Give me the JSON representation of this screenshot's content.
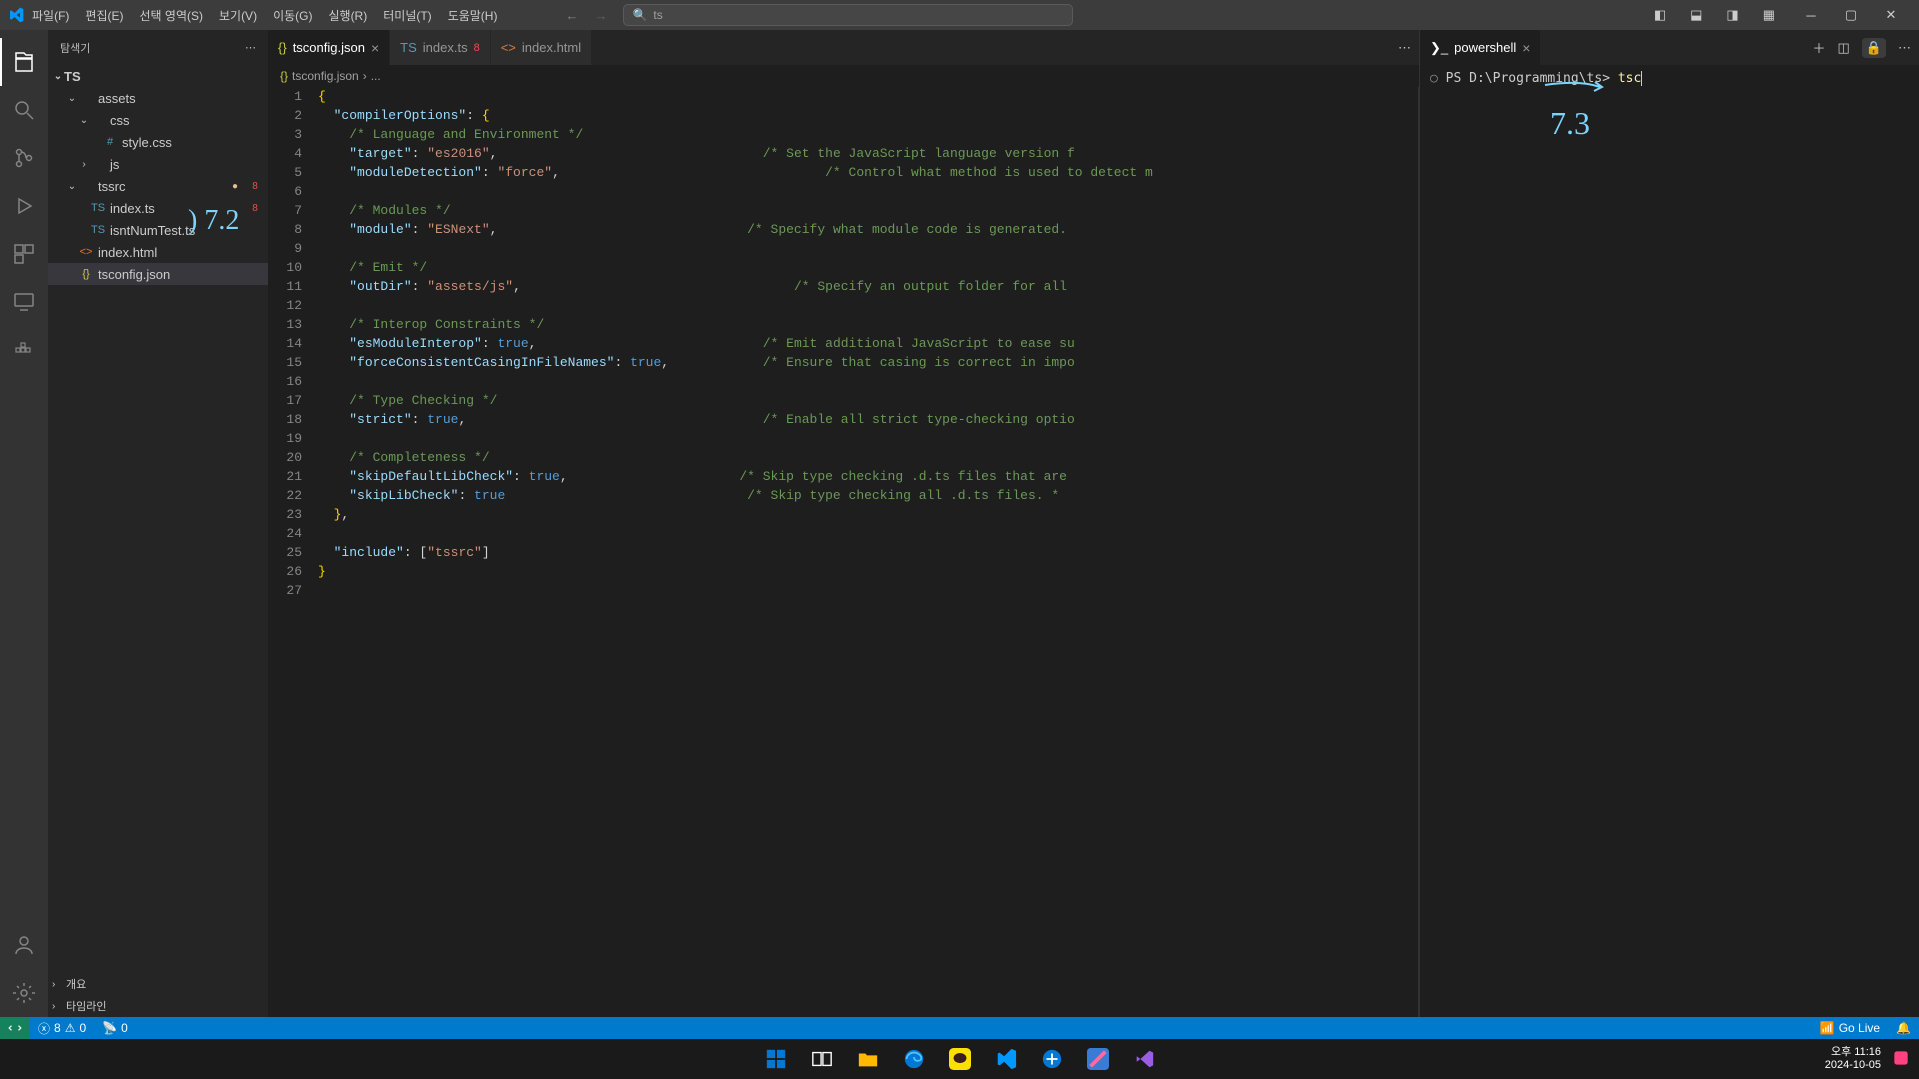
{
  "menu": [
    "파일(F)",
    "편집(E)",
    "선택 영역(S)",
    "보기(V)",
    "이동(G)",
    "실행(R)",
    "터미널(T)",
    "도움말(H)"
  ],
  "search_text": "ts",
  "sidebar": {
    "title": "탐색기",
    "root": "TS",
    "tree": [
      {
        "type": "folder",
        "depth": 1,
        "open": true,
        "label": "assets",
        "icon": ""
      },
      {
        "type": "folder",
        "depth": 2,
        "open": true,
        "label": "css",
        "icon": ""
      },
      {
        "type": "file",
        "depth": 3,
        "label": "style.css",
        "icon": "#",
        "iconClass": "file-css"
      },
      {
        "type": "folder",
        "depth": 2,
        "open": false,
        "label": "js",
        "icon": ""
      },
      {
        "type": "folder",
        "depth": 1,
        "open": true,
        "label": "tssrc",
        "icon": "",
        "mod": true,
        "err": "8"
      },
      {
        "type": "file",
        "depth": 2,
        "label": "index.ts",
        "icon": "TS",
        "iconClass": "file-ts",
        "err": "8"
      },
      {
        "type": "file",
        "depth": 2,
        "label": "isntNumTest.ts",
        "icon": "TS",
        "iconClass": "file-ts"
      },
      {
        "type": "file",
        "depth": 1,
        "label": "index.html",
        "icon": "<>",
        "iconClass": "file-html"
      },
      {
        "type": "file",
        "depth": 1,
        "label": "tsconfig.json",
        "icon": "{}",
        "iconClass": "file-json",
        "selected": true
      }
    ],
    "outline": [
      "개요",
      "타임라인"
    ]
  },
  "editor_tabs": [
    {
      "label": "tsconfig.json",
      "icon": "{}",
      "iconClass": "file-json",
      "active": true,
      "close": true
    },
    {
      "label": "index.ts",
      "icon": "TS",
      "iconClass": "file-ts",
      "err": "8"
    },
    {
      "label": "index.html",
      "icon": "<>",
      "iconClass": "file-html"
    }
  ],
  "breadcrumb": {
    "file": "tsconfig.json",
    "sep": "›",
    "rest": "..."
  },
  "code_lines": [
    [
      {
        "t": "brace",
        "v": "{"
      }
    ],
    [
      {
        "t": "punc",
        "v": "  "
      },
      {
        "t": "prop",
        "v": "\"compilerOptions\""
      },
      {
        "t": "punc",
        "v": ": "
      },
      {
        "t": "brace",
        "v": "{"
      }
    ],
    [
      {
        "t": "punc",
        "v": "    "
      },
      {
        "t": "comm",
        "v": "/* Language and Environment */"
      }
    ],
    [
      {
        "t": "punc",
        "v": "    "
      },
      {
        "t": "prop",
        "v": "\"target\""
      },
      {
        "t": "punc",
        "v": ": "
      },
      {
        "t": "str",
        "v": "\"es2016\""
      },
      {
        "t": "punc",
        "v": ","
      },
      {
        "t": "pad",
        "v": "                                  "
      },
      {
        "t": "comm",
        "v": "/* Set the JavaScript language version f"
      }
    ],
    [
      {
        "t": "punc",
        "v": "    "
      },
      {
        "t": "prop",
        "v": "\"moduleDetection\""
      },
      {
        "t": "punc",
        "v": ": "
      },
      {
        "t": "str",
        "v": "\"force\""
      },
      {
        "t": "punc",
        "v": ","
      },
      {
        "t": "pad",
        "v": "                                  "
      },
      {
        "t": "comm",
        "v": "/* Control what method is used to detect m"
      }
    ],
    [],
    [
      {
        "t": "punc",
        "v": "    "
      },
      {
        "t": "comm",
        "v": "/* Modules */"
      }
    ],
    [
      {
        "t": "punc",
        "v": "    "
      },
      {
        "t": "prop",
        "v": "\"module\""
      },
      {
        "t": "punc",
        "v": ": "
      },
      {
        "t": "str",
        "v": "\"ESNext\""
      },
      {
        "t": "punc",
        "v": ","
      },
      {
        "t": "pad",
        "v": "                                "
      },
      {
        "t": "comm",
        "v": "/* Specify what module code is generated."
      }
    ],
    [],
    [
      {
        "t": "punc",
        "v": "    "
      },
      {
        "t": "comm",
        "v": "/* Emit */"
      }
    ],
    [
      {
        "t": "punc",
        "v": "    "
      },
      {
        "t": "prop",
        "v": "\"outDir\""
      },
      {
        "t": "punc",
        "v": ": "
      },
      {
        "t": "str",
        "v": "\"assets/js\""
      },
      {
        "t": "punc",
        "v": ","
      },
      {
        "t": "pad",
        "v": "                                   "
      },
      {
        "t": "comm",
        "v": "/* Specify an output folder for all"
      }
    ],
    [],
    [
      {
        "t": "punc",
        "v": "    "
      },
      {
        "t": "comm",
        "v": "/* Interop Constraints */"
      }
    ],
    [
      {
        "t": "punc",
        "v": "    "
      },
      {
        "t": "prop",
        "v": "\"esModuleInterop\""
      },
      {
        "t": "punc",
        "v": ": "
      },
      {
        "t": "bool",
        "v": "true"
      },
      {
        "t": "punc",
        "v": ","
      },
      {
        "t": "pad",
        "v": "                             "
      },
      {
        "t": "comm",
        "v": "/* Emit additional JavaScript to ease su"
      }
    ],
    [
      {
        "t": "punc",
        "v": "    "
      },
      {
        "t": "prop",
        "v": "\"forceConsistentCasingInFileNames\""
      },
      {
        "t": "punc",
        "v": ": "
      },
      {
        "t": "bool",
        "v": "true"
      },
      {
        "t": "punc",
        "v": ","
      },
      {
        "t": "pad",
        "v": "            "
      },
      {
        "t": "comm",
        "v": "/* Ensure that casing is correct in impo"
      }
    ],
    [],
    [
      {
        "t": "punc",
        "v": "    "
      },
      {
        "t": "comm",
        "v": "/* Type Checking */"
      }
    ],
    [
      {
        "t": "punc",
        "v": "    "
      },
      {
        "t": "prop",
        "v": "\"strict\""
      },
      {
        "t": "punc",
        "v": ": "
      },
      {
        "t": "bool",
        "v": "true"
      },
      {
        "t": "punc",
        "v": ","
      },
      {
        "t": "pad",
        "v": "                                      "
      },
      {
        "t": "comm",
        "v": "/* Enable all strict type-checking optio"
      }
    ],
    [],
    [
      {
        "t": "punc",
        "v": "    "
      },
      {
        "t": "comm",
        "v": "/* Completeness */"
      }
    ],
    [
      {
        "t": "punc",
        "v": "    "
      },
      {
        "t": "prop",
        "v": "\"skipDefaultLibCheck\""
      },
      {
        "t": "punc",
        "v": ": "
      },
      {
        "t": "bool",
        "v": "true"
      },
      {
        "t": "punc",
        "v": ","
      },
      {
        "t": "pad",
        "v": "                      "
      },
      {
        "t": "comm",
        "v": "/* Skip type checking .d.ts files that are"
      }
    ],
    [
      {
        "t": "punc",
        "v": "    "
      },
      {
        "t": "prop",
        "v": "\"skipLibCheck\""
      },
      {
        "t": "punc",
        "v": ": "
      },
      {
        "t": "bool",
        "v": "true"
      },
      {
        "t": "pad",
        "v": "                               "
      },
      {
        "t": "comm",
        "v": "/* Skip type checking all .d.ts files. *"
      }
    ],
    [
      {
        "t": "punc",
        "v": "  "
      },
      {
        "t": "brace",
        "v": "}"
      },
      {
        "t": "punc",
        "v": ","
      }
    ],
    [],
    [
      {
        "t": "punc",
        "v": "  "
      },
      {
        "t": "prop",
        "v": "\"include\""
      },
      {
        "t": "punc",
        "v": ": ["
      },
      {
        "t": "str",
        "v": "\"tssrc\""
      },
      {
        "t": "punc",
        "v": "]"
      }
    ],
    [
      {
        "t": "brace",
        "v": "}"
      }
    ],
    []
  ],
  "terminal": {
    "tab_label": "powershell",
    "prompt": "PS D:\\Programming\\ts>",
    "command": "tsc"
  },
  "statusbar": {
    "errors": "8",
    "warnings": "0",
    "ports": "0",
    "golive": "Go Live"
  },
  "taskbar": {
    "time": "오후 11:16",
    "date": "2024-10-05"
  },
  "annotations": {
    "a72": ") 7.2",
    "a73": "7.3"
  }
}
